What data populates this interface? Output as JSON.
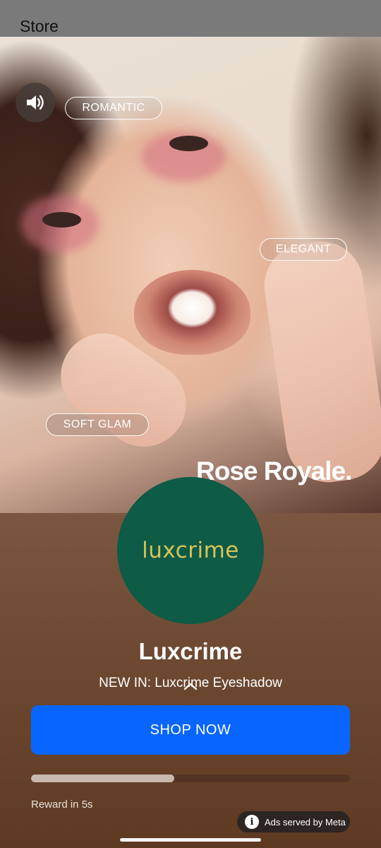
{
  "header": {
    "title": "Store"
  },
  "hero": {
    "tags": [
      "ROMANTIC",
      "ELEGANT",
      "SOFT GLAM"
    ],
    "tagline": "Rose Royale."
  },
  "ad": {
    "logo_text": "luxcrime",
    "advertiser": "Luxcrime",
    "headline": "NEW IN: Luxcrime Eyeshadow",
    "cta_label": "SHOP NOW",
    "progress_percent": 45,
    "reward_text": "Reward in 5s",
    "served_by": "Ads served by Meta"
  },
  "icons": {
    "sound": "speaker-volume-icon",
    "expand": "chevron-up-icon",
    "info": "info-icon"
  },
  "colors": {
    "cta": "#0866ff",
    "logo_background": "#0e5b46",
    "logo_text": "#d8c35a",
    "panel": "#6e4a33"
  }
}
